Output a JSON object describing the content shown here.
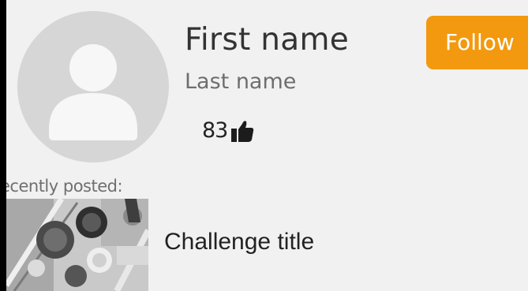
{
  "profile": {
    "first_name": "First name",
    "last_name": "Last name",
    "likes_count": "83",
    "avatar_icon": "user-placeholder-icon",
    "like_icon": "thumbs-up-icon"
  },
  "follow": {
    "label": "Follow",
    "color": "#f2990f"
  },
  "recent": {
    "label": "ecently posted:",
    "items": [
      {
        "title": "Challenge title",
        "thumbnail_icon": "challenge-thumbnail-image"
      }
    ]
  }
}
